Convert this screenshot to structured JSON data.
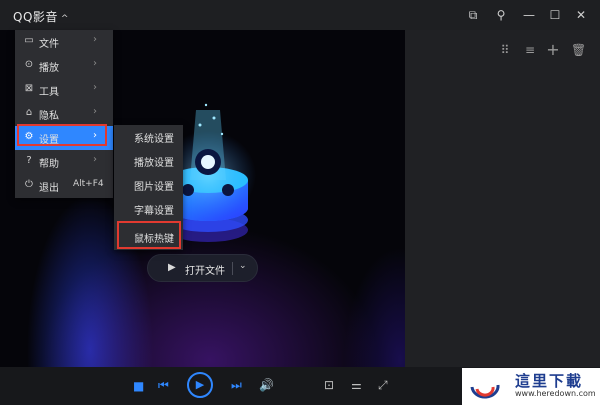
{
  "app": {
    "title": "QQ影音",
    "title_caret": "^"
  },
  "window_controls": [
    {
      "name": "mini-mode-icon",
      "glyph": "⧉"
    },
    {
      "name": "pin-icon",
      "glyph": "⚲"
    },
    {
      "name": "minimize-icon",
      "glyph": "—"
    },
    {
      "name": "maximize-icon",
      "glyph": "☐"
    },
    {
      "name": "close-icon",
      "glyph": "✕"
    }
  ],
  "playlist_tools": [
    {
      "name": "grid-view-icon",
      "glyph": "⠿"
    },
    {
      "name": "sort-icon",
      "glyph": "≡"
    },
    {
      "name": "add-icon",
      "glyph": "+"
    },
    {
      "name": "delete-icon",
      "glyph": "🗑"
    }
  ],
  "main_menu": {
    "items": [
      {
        "name": "file",
        "icon": "folder-icon",
        "glyph": "▭",
        "label": "文件",
        "arrow": "›"
      },
      {
        "name": "play",
        "icon": "play-circle-icon",
        "glyph": "⊙",
        "label": "播放",
        "arrow": "›"
      },
      {
        "name": "tools",
        "icon": "tools-icon",
        "glyph": "⊠",
        "label": "工具",
        "arrow": "›"
      },
      {
        "name": "privacy",
        "icon": "lock-icon",
        "glyph": "⌂",
        "label": "隐私",
        "arrow": "›"
      },
      {
        "name": "settings",
        "icon": "gear-icon",
        "glyph": "⚙",
        "label": "设置",
        "arrow": "›",
        "active": true
      },
      {
        "name": "help",
        "icon": "help-icon",
        "glyph": "?",
        "label": "帮助",
        "arrow": "›"
      },
      {
        "name": "exit",
        "icon": "power-icon",
        "glyph": "⏻",
        "label": "退出",
        "shortcut": "Alt+F4"
      }
    ]
  },
  "settings_submenu": {
    "items": [
      "系统设置",
      "播放设置",
      "图片设置",
      "字幕设置",
      "鼠标热键"
    ]
  },
  "open_button": {
    "icon": "▶",
    "label": "打开文件",
    "dropdown": "⌄"
  },
  "controls": {
    "stop": "■",
    "prev": "⏮",
    "play": "▶",
    "next": "⏭",
    "volume": "🔊",
    "screenshot": "⊡",
    "equalizer": "⚌",
    "fullscreen": "⤢"
  },
  "watermark": {
    "title": "這里下載",
    "url": "www.heredown.com"
  },
  "colors": {
    "accent": "#2f87ff",
    "highlight_box": "#e23a30"
  }
}
